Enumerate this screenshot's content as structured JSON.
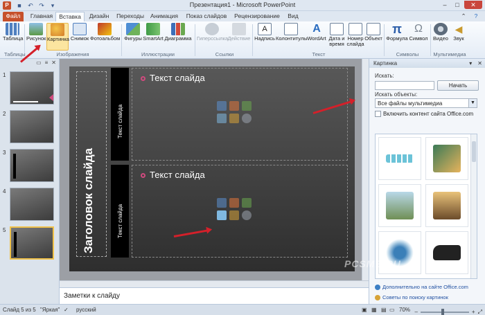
{
  "window": {
    "title": "Презентация1 - Microsoft PowerPoint"
  },
  "tabs": [
    {
      "label": "Файл"
    },
    {
      "label": "Главная"
    },
    {
      "label": "Вставка"
    },
    {
      "label": "Дизайн"
    },
    {
      "label": "Переходы"
    },
    {
      "label": "Анимация"
    },
    {
      "label": "Показ слайдов"
    },
    {
      "label": "Рецензирование"
    },
    {
      "label": "Вид"
    }
  ],
  "ribbon": {
    "buttons": {
      "table": "Таблица",
      "picture": "Рисунок",
      "clipart": "Картинка",
      "screenshot": "Снимок",
      "album": "Фотоальбом",
      "shapes": "Фигуры",
      "smartart": "SmartArt",
      "chart": "Диаграмма",
      "hyperlink": "Гиперссылка",
      "action": "Действие",
      "textbox": "Надпись",
      "header": "Колонтитулы",
      "wordart": "WordArt",
      "datetime": "Дата и время",
      "slidenum": "Номер слайда",
      "object": "Объект",
      "formula": "Формула",
      "symbol": "Символ",
      "video": "Видео",
      "sound": "Звук"
    },
    "groups": {
      "tables": "Таблицы",
      "images": "Изображения",
      "illustrations": "Иллюстрации",
      "links": "Ссылки",
      "text": "Текст",
      "symbols": "Символы",
      "multimedia": "Мультимедиа"
    }
  },
  "thumbnails": [
    "1",
    "2",
    "3",
    "4",
    "5"
  ],
  "slide": {
    "title": "Заголовок слайда",
    "vertical_text_1": "Текст слайда",
    "vertical_text_2": "Текст слайда",
    "bullet_1": "Текст слайда",
    "bullet_2": "Текст слайда"
  },
  "notes": {
    "placeholder": "Заметки к слайду"
  },
  "clipart_pane": {
    "title": "Картинка",
    "search_label": "Искать:",
    "search_value": "",
    "go_button": "Начать",
    "types_label": "Искать объекты:",
    "types_value": "Все файлы мультимедиа",
    "office_check": "Включить контент сайта Office.com",
    "link_more": "Дополнительно на сайте Office.com",
    "link_tips": "Советы по поиску картинок"
  },
  "status": {
    "slide": "Слайд 5 из 5",
    "theme": "\"Яркая\"",
    "language": "русский",
    "zoom": "70%"
  },
  "watermark": "PCSME.RU",
  "colors": {
    "accent_file_tab": "#c6502b",
    "arrow": "#d4202a",
    "bullet": "#d04a7e"
  }
}
